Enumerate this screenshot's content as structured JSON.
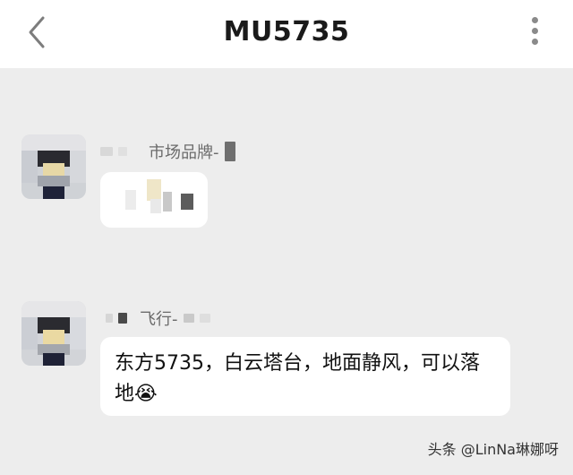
{
  "header": {
    "title": "MU5735",
    "back_icon": "chevron-left-icon",
    "menu_icon": "more-vertical-icon"
  },
  "messages": [
    {
      "sender_name": "市场品牌-",
      "text": ""
    },
    {
      "sender_name": "飞行-",
      "text": "东方5735，白云塔台，地面静风，可以落地😭"
    }
  ],
  "watermark": "头条 @LinNa琳娜呀"
}
